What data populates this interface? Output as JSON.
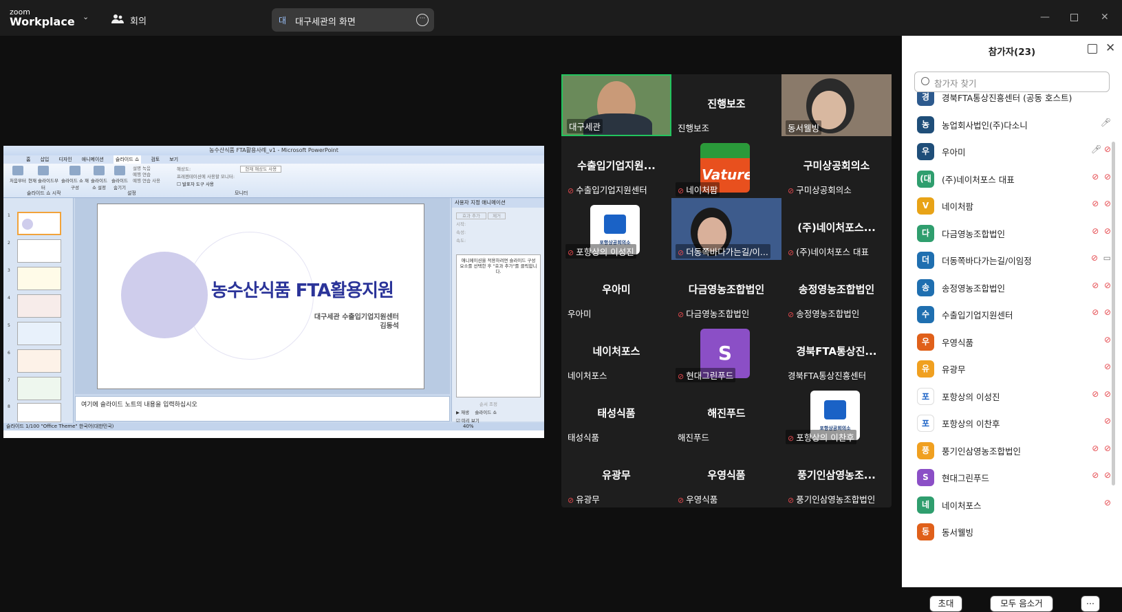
{
  "app": {
    "logo_top": "zoom",
    "logo_bottom": "Workplace",
    "meeting_label": "회의"
  },
  "share": {
    "badge": "대",
    "label": "대구세관의 화면"
  },
  "ppt": {
    "title": "농수산식품 FTA활용사례_v1 - Microsoft PowerPoint",
    "tabs": [
      "홈",
      "삽입",
      "디자인",
      "애니메이션",
      "슬라이드 쇼",
      "검토",
      "보기"
    ],
    "buttons": [
      "처음부터",
      "현재 슬라이드부터",
      "슬라이드 쇼 재구성",
      "슬라이드 쇼 설정",
      "슬라이드 숨기기"
    ],
    "options": [
      "설명 녹음",
      "예행 연습",
      "예행 연습 사용"
    ],
    "resolution_label": "해상도:",
    "resolution_value": "현재 해상도 사용",
    "show_on_label": "프레젠테이션에 사용할 모니터:",
    "presenter_tools": "발표자 도구 사용",
    "groups": [
      "슬라이드 쇼 시작",
      "설정",
      "모니터"
    ],
    "slide_title": "농수산식품 FTA활용지원",
    "slide_sub1": "대구세관 수출입기업지원센터",
    "slide_sub2": "김동석",
    "notes": "여기에 슬라이드 노트의 내용을 입력하십시오",
    "anim_header": "사용자 지정 애니메이션",
    "anim_add": "효과 추가",
    "anim_remove": "제거",
    "anim_fields": [
      "시작:",
      "속성:",
      "속도:"
    ],
    "anim_hint": "애니메이션을 적용하려면 슬라이드 구성 요소를 선택한 후 \"효과 추가\"를 클릭합니다.",
    "reorder": "순서 조정",
    "play": "재생",
    "slideshow": "슬라이드 쇼",
    "autopreview": "미리 보기",
    "status": "슬라이드 1/100   \"Office Theme\"    한국어(대한민국)",
    "zoom": "40%",
    "slide_nums": [
      "1",
      "2",
      "3",
      "4",
      "5",
      "6",
      "7",
      "8"
    ]
  },
  "tiles": [
    {
      "name": "",
      "label": "대구세관",
      "muted": false,
      "kind": "photo1"
    },
    {
      "name": "진행보조",
      "label": "진행보조",
      "muted": false,
      "kind": "name"
    },
    {
      "name": "",
      "label": "동서웰빙",
      "muted": false,
      "kind": "photo2"
    },
    {
      "name": "수출입기업지원...",
      "label": "수출입기업지원센터",
      "muted": true,
      "kind": "name"
    },
    {
      "name": "",
      "label": "네이처팜",
      "muted": true,
      "kind": "vature"
    },
    {
      "name": "구미상공회의소",
      "label": "구미상공회의소",
      "muted": true,
      "kind": "name"
    },
    {
      "name": "",
      "label": "포항상의 이성진",
      "muted": true,
      "kind": "pohang"
    },
    {
      "name": "",
      "label": "더동쪽바다가는길/이...",
      "muted": true,
      "kind": "photo3"
    },
    {
      "name": "(주)네이처포스...",
      "label": "(주)네이처포스 대표",
      "muted": true,
      "kind": "name"
    },
    {
      "name": "우아미",
      "label": "우아미",
      "muted": false,
      "kind": "name"
    },
    {
      "name": "다금영농조합법인",
      "label": "다금영농조합법인",
      "muted": true,
      "kind": "name"
    },
    {
      "name": "송정영농조합법인",
      "label": "송정영농조합법인",
      "muted": true,
      "kind": "name"
    },
    {
      "name": "네이처포스",
      "label": "네이처포스",
      "muted": false,
      "kind": "name"
    },
    {
      "name": "",
      "label": "현대그린푸드",
      "muted": true,
      "kind": "S"
    },
    {
      "name": "경북FTA통상진...",
      "label": "경북FTA통상진흥센터",
      "muted": false,
      "kind": "name"
    },
    {
      "name": "태성식품",
      "label": "태성식품",
      "muted": false,
      "kind": "name"
    },
    {
      "name": "해진푸드",
      "label": "해진푸드",
      "muted": false,
      "kind": "name"
    },
    {
      "name": "",
      "label": "포항상의 이찬후",
      "muted": true,
      "kind": "pohang"
    },
    {
      "name": "유광무",
      "label": "유광무",
      "muted": true,
      "kind": "name"
    },
    {
      "name": "우영식품",
      "label": "우영식품",
      "muted": true,
      "kind": "name"
    },
    {
      "name": "풍기인삼영농조...",
      "label": "풍기인삼영농조합법인",
      "muted": true,
      "kind": "name"
    }
  ],
  "logos": {
    "vature_text": "Vature",
    "pohang_text": "포항상공회의소",
    "s_letter": "S"
  },
  "panel": {
    "title": "참가자(23)",
    "search_placeholder": "참가자 찾기",
    "participants": [
      {
        "av": "경",
        "color": "#2d5a8e",
        "name": "경북FTA통상진흥센터 (공동 호스트)",
        "icons": ""
      },
      {
        "av": "농",
        "color": "#1f4e79",
        "name": "농업회사법인(주)다소니",
        "icons": "mic"
      },
      {
        "av": "우",
        "color": "#1f4e79",
        "name": "우아미",
        "icons": "mic-cam"
      },
      {
        "av": "(대",
        "color": "#2f9e6e",
        "name": "(주)네이처포스 대표",
        "icons": "mute-cam"
      },
      {
        "av": "V",
        "color": "#e8a317",
        "name": "네이처팜",
        "icons": "mute-cam"
      },
      {
        "av": "다",
        "color": "#2f9e6e",
        "name": "다금영농조합법인",
        "icons": "mute-cam"
      },
      {
        "av": "더",
        "color": "#1f6fb0",
        "name": "더동쪽바다가는길/이임정",
        "icons": "mute-video"
      },
      {
        "av": "송",
        "color": "#1f6fb0",
        "name": "송정영농조합법인",
        "icons": "mute-cam"
      },
      {
        "av": "수",
        "color": "#1f6fb0",
        "name": "수출입기업지원센터",
        "icons": "mute-cam"
      },
      {
        "av": "우",
        "color": "#e0601a",
        "name": "우영식품",
        "icons": "mute"
      },
      {
        "av": "유",
        "color": "#f0a020",
        "name": "유광무",
        "icons": "mute"
      },
      {
        "av": "포",
        "color": "#ffffff",
        "name": "포항상의 이성진",
        "icons": "mute-cam"
      },
      {
        "av": "포",
        "color": "#ffffff",
        "name": "포항상의 이찬후",
        "icons": "mute"
      },
      {
        "av": "풍",
        "color": "#f0a020",
        "name": "풍기인삼영농조합법인",
        "icons": "mute-cam"
      },
      {
        "av": "S",
        "color": "#8b4fc6",
        "name": "현대그린푸드",
        "icons": "mute-cam"
      },
      {
        "av": "네",
        "color": "#2f9e6e",
        "name": "네이처포스",
        "icons": "cam"
      },
      {
        "av": "동",
        "color": "#e0601a",
        "name": "동서웰빙",
        "icons": ""
      }
    ],
    "invite": "초대",
    "mute_all": "모두 음소거",
    "more": "···"
  },
  "colors": {
    "accent_green": "#22c55e",
    "mute_red": "#e5484d",
    "slide_title": "#2b3499"
  }
}
